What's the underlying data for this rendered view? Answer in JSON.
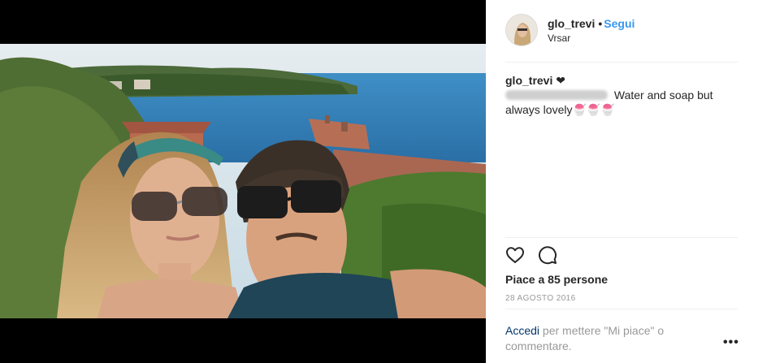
{
  "post": {
    "username": "glo_trevi",
    "separator": "•",
    "follow_label": "Segui",
    "location": "Vrsar"
  },
  "caption": {
    "username": "glo_trevi",
    "heart": "❤",
    "text": " Water and soap but always lovely",
    "emoji": "🍧🍧🍧"
  },
  "actions": {
    "like_icon": "heart-outline-icon",
    "comment_icon": "speech-bubble-icon"
  },
  "likes": "Piace a 85 persone",
  "date": "28 AGOSTO 2016",
  "login": {
    "link": "Accedi",
    "text": " per mettere \"Mi piace\" o commentare."
  },
  "more_label": "•••",
  "colors": {
    "follow": "#3897f0",
    "link": "#003569",
    "muted": "#999999",
    "divider": "#efefef"
  }
}
